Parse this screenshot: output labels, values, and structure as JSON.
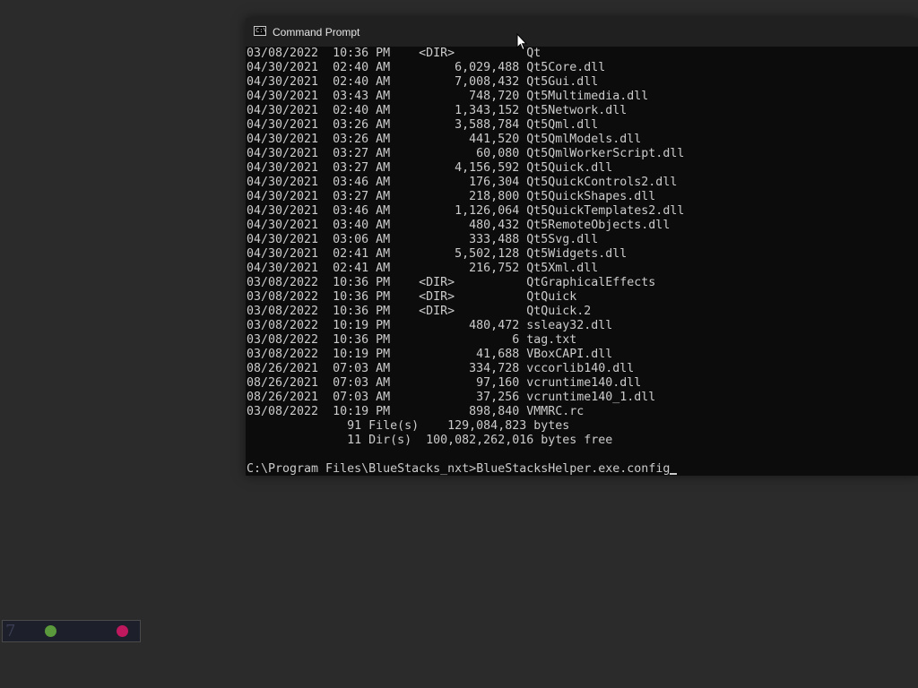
{
  "window": {
    "title": "Command Prompt",
    "icon": "cmd-icon",
    "icon_text": "C:\\"
  },
  "console": {
    "lines": [
      "03/08/2022  10:36 PM    <DIR>          Qt",
      "04/30/2021  02:40 AM         6,029,488 Qt5Core.dll",
      "04/30/2021  02:40 AM         7,008,432 Qt5Gui.dll",
      "04/30/2021  03:43 AM           748,720 Qt5Multimedia.dll",
      "04/30/2021  02:40 AM         1,343,152 Qt5Network.dll",
      "04/30/2021  03:26 AM         3,588,784 Qt5Qml.dll",
      "04/30/2021  03:26 AM           441,520 Qt5QmlModels.dll",
      "04/30/2021  03:27 AM            60,080 Qt5QmlWorkerScript.dll",
      "04/30/2021  03:27 AM         4,156,592 Qt5Quick.dll",
      "04/30/2021  03:46 AM           176,304 Qt5QuickControls2.dll",
      "04/30/2021  03:27 AM           218,800 Qt5QuickShapes.dll",
      "04/30/2021  03:46 AM         1,126,064 Qt5QuickTemplates2.dll",
      "04/30/2021  03:40 AM           480,432 Qt5RemoteObjects.dll",
      "04/30/2021  03:06 AM           333,488 Qt5Svg.dll",
      "04/30/2021  02:41 AM         5,502,128 Qt5Widgets.dll",
      "04/30/2021  02:41 AM           216,752 Qt5Xml.dll",
      "03/08/2022  10:36 PM    <DIR>          QtGraphicalEffects",
      "03/08/2022  10:36 PM    <DIR>          QtQuick",
      "03/08/2022  10:36 PM    <DIR>          QtQuick.2",
      "03/08/2022  10:19 PM           480,472 ssleay32.dll",
      "03/08/2022  10:36 PM                 6 tag.txt",
      "03/08/2022  10:19 PM            41,688 VBoxCAPI.dll",
      "08/26/2021  07:03 AM           334,728 vccorlib140.dll",
      "08/26/2021  07:03 AM            97,160 vcruntime140.dll",
      "08/26/2021  07:03 AM            37,256 vcruntime140_1.dll",
      "03/08/2022  10:19 PM           898,840 VMMRC.rc",
      "              91 File(s)    129,084,823 bytes",
      "              11 Dir(s)  100,082,262,016 bytes free",
      ""
    ],
    "prompt": "C:\\Program Files\\BlueStacks_nxt>",
    "input": "BlueStacksHelper.exe.config"
  },
  "taskbar_widget": {
    "glyph": "7",
    "colors": {
      "green": "#5b9a3c",
      "pink": "#c0185f"
    }
  },
  "colors": {
    "console_bg": "#0c0c0c",
    "console_text": "#cccccc",
    "titlebar_bg": "#202020",
    "desktop_bg": "#2b2b2b"
  }
}
